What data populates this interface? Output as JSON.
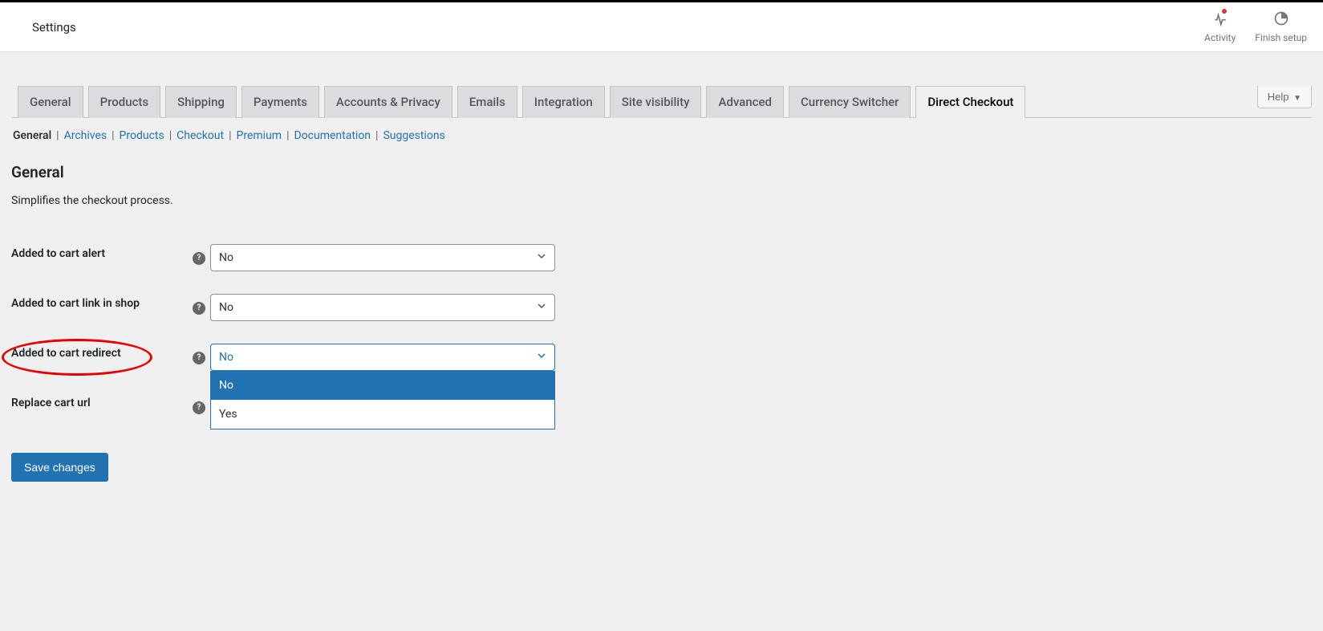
{
  "topbar": {
    "title": "Settings",
    "activity_label": "Activity",
    "finish_label": "Finish setup"
  },
  "help_button": "Help",
  "tabs": [
    {
      "label": "General",
      "active": false
    },
    {
      "label": "Products",
      "active": false
    },
    {
      "label": "Shipping",
      "active": false
    },
    {
      "label": "Payments",
      "active": false
    },
    {
      "label": "Accounts & Privacy",
      "active": false
    },
    {
      "label": "Emails",
      "active": false
    },
    {
      "label": "Integration",
      "active": false
    },
    {
      "label": "Site visibility",
      "active": false
    },
    {
      "label": "Advanced",
      "active": false
    },
    {
      "label": "Currency Switcher",
      "active": false
    },
    {
      "label": "Direct Checkout",
      "active": true
    }
  ],
  "subnav": [
    {
      "label": "General",
      "current": true
    },
    {
      "label": "Archives",
      "current": false
    },
    {
      "label": "Products",
      "current": false
    },
    {
      "label": "Checkout",
      "current": false
    },
    {
      "label": "Premium",
      "current": false
    },
    {
      "label": "Documentation",
      "current": false
    },
    {
      "label": "Suggestions",
      "current": false
    }
  ],
  "section": {
    "title": "General",
    "desc": "Simplifies the checkout process."
  },
  "fields": {
    "alert": {
      "label": "Added to cart alert",
      "value": "No"
    },
    "link_shop": {
      "label": "Added to cart link in shop",
      "value": "No"
    },
    "redirect": {
      "label": "Added to cart redirect",
      "value": "No",
      "open": true,
      "options": [
        "No",
        "Yes"
      ],
      "highlighted": true
    },
    "replace_url": {
      "label": "Replace cart url",
      "value": ""
    }
  },
  "save_label": "Save changes"
}
